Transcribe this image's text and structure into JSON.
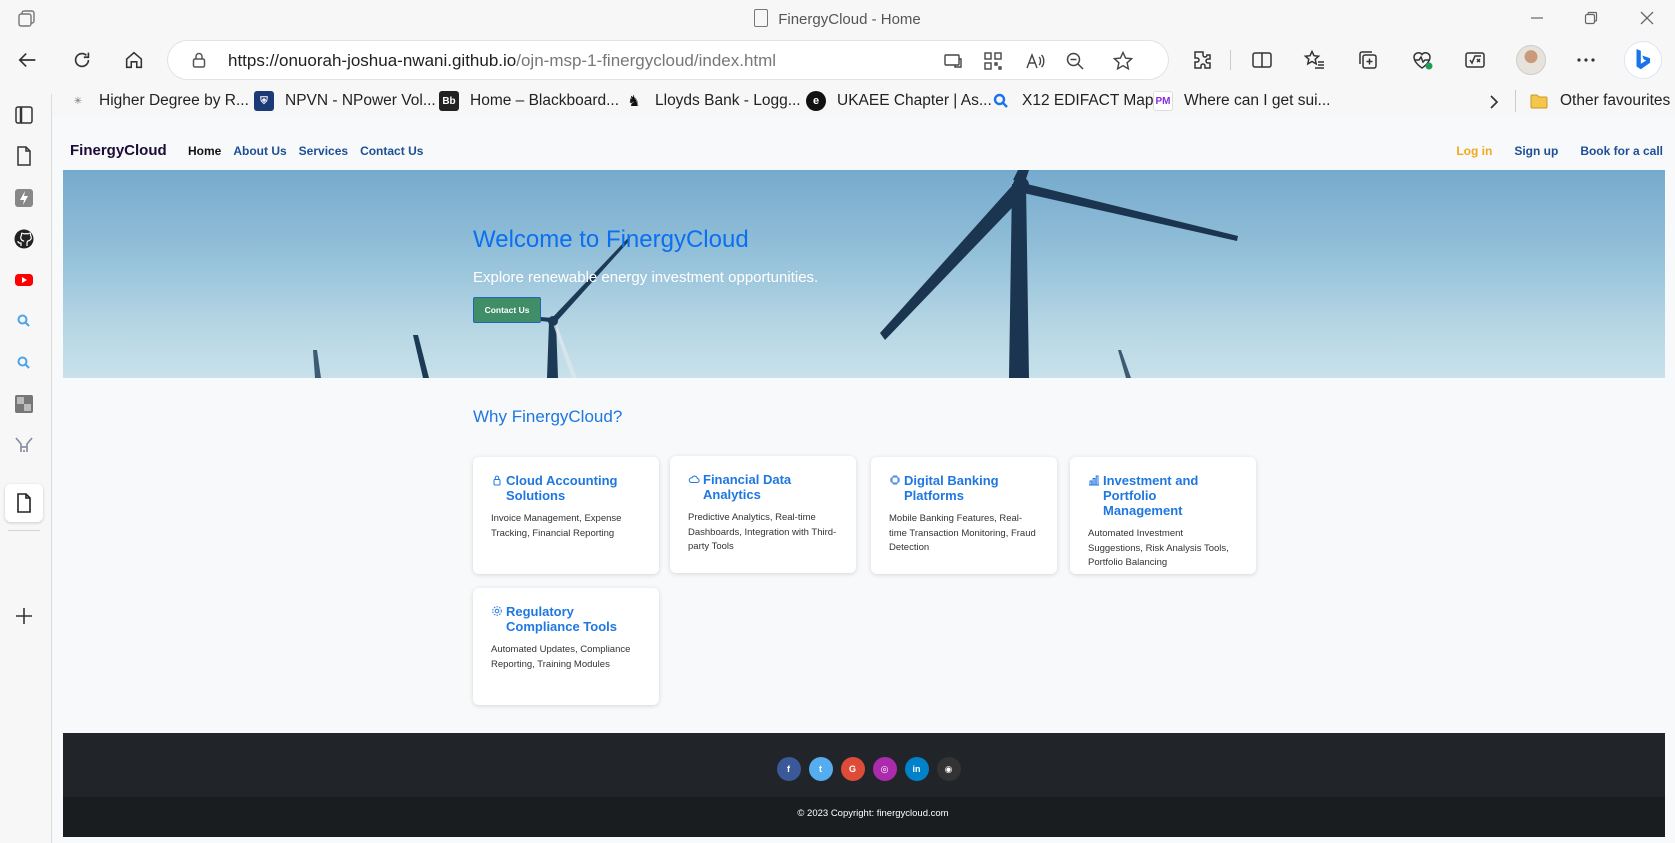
{
  "window": {
    "title": "FinergyCloud - Home",
    "icons": {
      "tab_actions": "tab-actions-icon",
      "minimize": "minimize-icon",
      "restore": "restore-icon",
      "close": "close-icon"
    }
  },
  "address_bar": {
    "url_host": "https://onuorah-joshua-nwani.github.io",
    "url_path": "/ojn-msp-1-finergycloud/index.html"
  },
  "favourites": [
    {
      "label": "Higher Degree by R...",
      "icon": "network-icon",
      "color": "#7a7a7a"
    },
    {
      "label": "NPVN - NPower Vol...",
      "icon": "crest-icon",
      "color": "#1d3a78"
    },
    {
      "label": "Home – Blackboard...",
      "icon": "blackboard-icon",
      "color": "#222222"
    },
    {
      "label": "Lloyds Bank - Logg...",
      "icon": "horse-icon",
      "color": "#111111"
    },
    {
      "label": "UKAEE Chapter | As...",
      "icon": "ukaee-icon",
      "color": "#111111"
    },
    {
      "label": "X12 EDIFACT Map",
      "icon": "search-icon",
      "color": "#1a73e8"
    },
    {
      "label": "Where can I get sui...",
      "icon": "pm-logo-icon",
      "color": "#8a2be2"
    }
  ],
  "other_favourites": "Other favourites",
  "site": {
    "brand": "FinergyCloud",
    "nav": [
      "Home",
      "About Us",
      "Services",
      "Contact Us"
    ],
    "nav_right": [
      "Log in",
      "Sign up",
      "Book for a call"
    ],
    "colors": {
      "brand": "#1b0c38",
      "link": "#1d4f96",
      "login": "#f0a81e",
      "accent": "#1f77e0",
      "button": "#3f8e68",
      "footer": "#212529"
    },
    "hero": {
      "title": "Welcome to FinergyCloud",
      "subtitle": "Explore renewable energy investment opportunities.",
      "button": "Contact Us"
    },
    "why_title": "Why FinergyCloud?",
    "cards": [
      {
        "title": "Cloud Accounting Solutions",
        "desc": "Invoice Management, Expense Tracking, Financial Reporting",
        "icon": "lock-icon"
      },
      {
        "title": "Financial Data Analytics",
        "desc": "Predictive Analytics, Real-time Dashboards, Integration with Third-party Tools",
        "icon": "cloud-icon"
      },
      {
        "title": "Digital Banking Platforms",
        "desc": "Mobile Banking Features, Real-time Transaction Monitoring, Fraud Detection",
        "icon": "chip-icon"
      },
      {
        "title": "Investment and Portfolio Management",
        "desc": "Automated Investment Suggestions, Risk Analysis Tools, Portfolio Balancing",
        "icon": "bar-chart-icon"
      },
      {
        "title": "Regulatory Compliance Tools",
        "desc": "Automated Updates, Compliance Reporting, Training Modules",
        "icon": "gear-icon"
      }
    ],
    "social": [
      {
        "name": "facebook",
        "glyph": "f",
        "color": "#3b5998"
      },
      {
        "name": "twitter",
        "glyph": "t",
        "color": "#55acee"
      },
      {
        "name": "google",
        "glyph": "G",
        "color": "#dd4b39"
      },
      {
        "name": "instagram",
        "glyph": "◎",
        "color": "#ac2bac"
      },
      {
        "name": "linkedin",
        "glyph": "in",
        "color": "#0082ca"
      },
      {
        "name": "github",
        "glyph": "◉",
        "color": "#333333"
      }
    ],
    "copyright": "© 2023 Copyright: finergycloud.com"
  }
}
